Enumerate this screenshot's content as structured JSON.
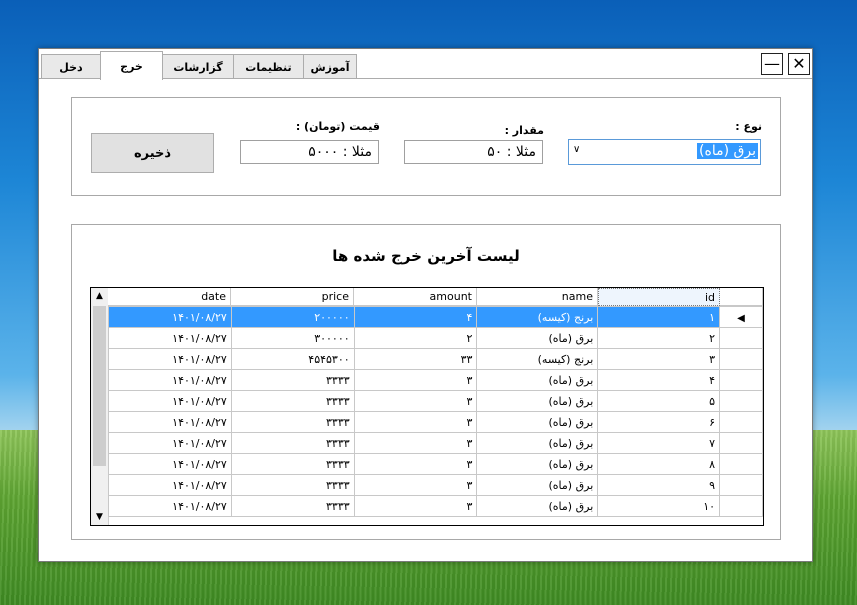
{
  "tabs": [
    "دخل",
    "خرج",
    "گزارشات",
    "تنظیمات",
    "آموزش"
  ],
  "window_buttons": {
    "minimize": "—",
    "close": "✕"
  },
  "form": {
    "type_label": "نوع :",
    "type_value": "برق (ماه)",
    "amount_label": "مقدار :",
    "amount_placeholder": "مثلا : ۵۰",
    "price_label": "قیمت (تومان) :",
    "price_placeholder": "مثلا : ۵۰۰۰",
    "save_label": "ذخیره"
  },
  "list_title": "لیست آخرین خرج شده ها",
  "table": {
    "columns": [
      "date",
      "price",
      "amount",
      "name",
      "id"
    ],
    "rows": [
      [
        "۱۴۰۱/۰۸/۲۷",
        "۲۰۰۰۰۰",
        "۴",
        "برنج (کیسه)",
        "۱"
      ],
      [
        "۱۴۰۱/۰۸/۲۷",
        "۳۰۰۰۰۰",
        "۲",
        "برق (ماه)",
        "۲"
      ],
      [
        "۱۴۰۱/۰۸/۲۷",
        "۴۵۴۵۳۰۰",
        "۳۳",
        "برنج (کیسه)",
        "۳"
      ],
      [
        "۱۴۰۱/۰۸/۲۷",
        "۳۳۳۳",
        "۳",
        "برق (ماه)",
        "۴"
      ],
      [
        "۱۴۰۱/۰۸/۲۷",
        "۳۳۳۳",
        "۳",
        "برق (ماه)",
        "۵"
      ],
      [
        "۱۴۰۱/۰۸/۲۷",
        "۳۳۳۳",
        "۳",
        "برق (ماه)",
        "۶"
      ],
      [
        "۱۴۰۱/۰۸/۲۷",
        "۳۳۳۳",
        "۳",
        "برق (ماه)",
        "۷"
      ],
      [
        "۱۴۰۱/۰۸/۲۷",
        "۳۳۳۳",
        "۳",
        "برق (ماه)",
        "۸"
      ],
      [
        "۱۴۰۱/۰۸/۲۷",
        "۳۳۳۳",
        "۳",
        "برق (ماه)",
        "۹"
      ],
      [
        "۱۴۰۱/۰۸/۲۷",
        "۳۳۳۳",
        "۳",
        "برق (ماه)",
        "۱۰"
      ]
    ],
    "selected_row": 0
  },
  "colors": {
    "selection": "#3399ff",
    "combo_border": "#5a9ad9"
  }
}
